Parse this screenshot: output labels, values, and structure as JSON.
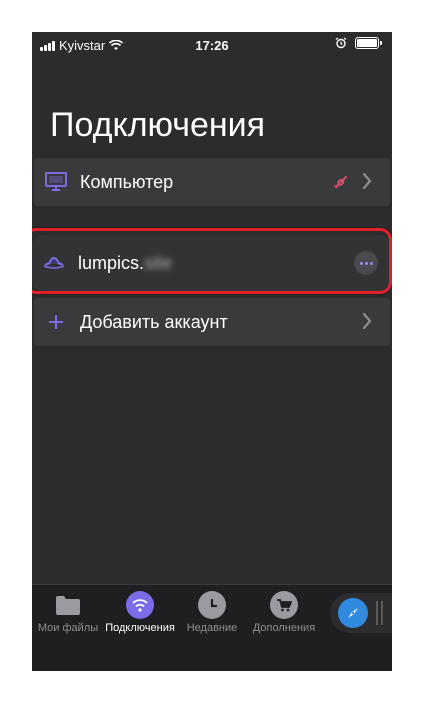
{
  "status_bar": {
    "carrier": "Kyivstar",
    "time": "17:26"
  },
  "page": {
    "title": "Подключения"
  },
  "rows": {
    "computer": {
      "label": "Компьютер",
      "icon": "monitor-icon"
    },
    "account": {
      "label": "lumpics.",
      "label_blurred": "site",
      "icon": "hat-icon"
    },
    "add_account": {
      "label": "Добавить аккаунт",
      "icon": "plus-icon"
    }
  },
  "tabbar": {
    "tabs": [
      {
        "label": "Мои файлы",
        "icon": "folder-icon"
      },
      {
        "label": "Подключения",
        "icon": "wifi-icon"
      },
      {
        "label": "Недавние",
        "icon": "clock-icon"
      },
      {
        "label": "Дополнения",
        "icon": "cart-icon"
      }
    ],
    "active_tab": "Подключения",
    "compass_icon": "compass-icon"
  },
  "colors": {
    "background": "#2c2c2e",
    "row": "#3a3a3c",
    "accent": "#7b6ce8",
    "highlight": "#e0202a",
    "link_off": "#e0506a"
  }
}
